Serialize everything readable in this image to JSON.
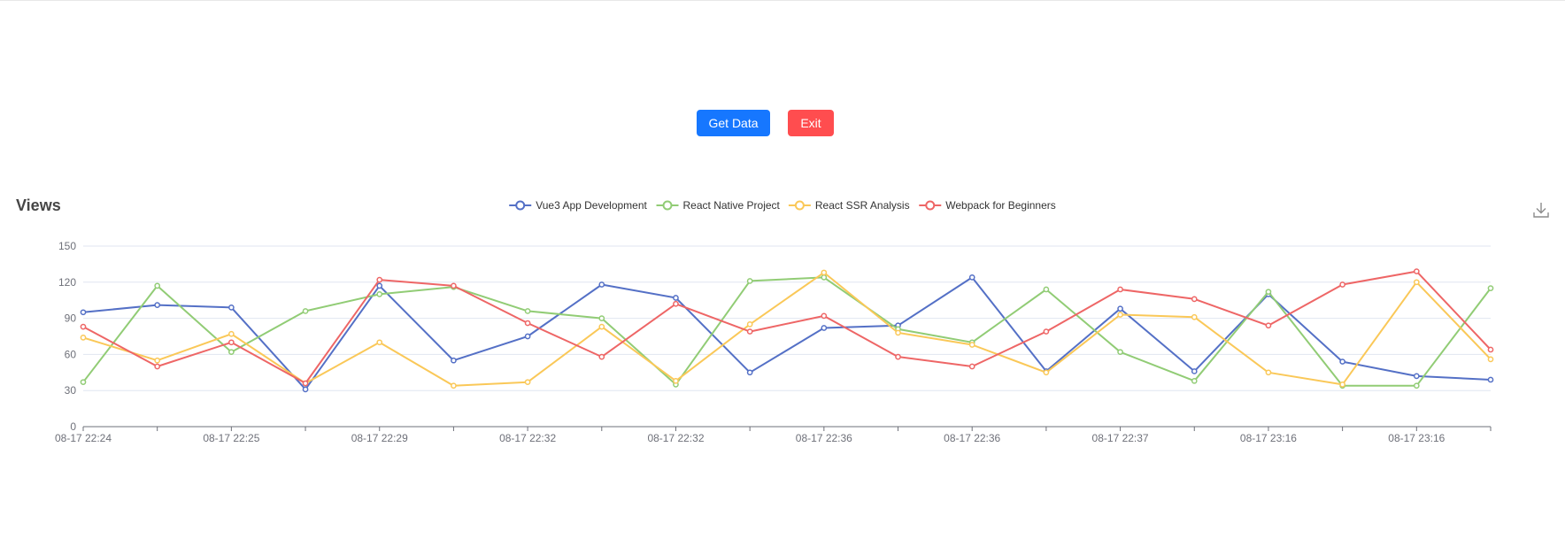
{
  "buttons": {
    "get_data": "Get Data",
    "exit": "Exit"
  },
  "colors": {
    "primary": "#1677ff",
    "danger": "#ff4d4f"
  },
  "icons": {
    "download": "download-icon"
  },
  "chart_data": {
    "type": "line",
    "title": "Views",
    "legend_position": "top-center",
    "grid": true,
    "ylim": [
      0,
      150
    ],
    "y_ticks": [
      0,
      30,
      60,
      90,
      120,
      150
    ],
    "categories": [
      "08-17 22:24",
      "",
      "08-17 22:25",
      "",
      "08-17 22:29",
      "",
      "08-17 22:32",
      "",
      "08-17 22:32",
      "",
      "08-17 22:36",
      "",
      "08-17 22:36",
      "",
      "08-17 22:37",
      "",
      "08-17 23:16",
      "",
      "08-17 23:16",
      ""
    ],
    "series": [
      {
        "name": "Vue3 App Development",
        "color": "#5470c6",
        "values": [
          95,
          101,
          99,
          31,
          117,
          55,
          75,
          118,
          107,
          45,
          82,
          84,
          124,
          46,
          98,
          46,
          110,
          54,
          42,
          39
        ]
      },
      {
        "name": "React Native Project",
        "color": "#91cc75",
        "values": [
          37,
          117,
          62,
          96,
          110,
          116,
          96,
          90,
          35,
          121,
          124,
          81,
          70,
          114,
          62,
          38,
          112,
          34,
          34,
          115
        ]
      },
      {
        "name": "React SSR Analysis",
        "color": "#fac858",
        "values": [
          74,
          55,
          77,
          36,
          70,
          34,
          37,
          83,
          38,
          85,
          128,
          78,
          68,
          45,
          93,
          91,
          45,
          35,
          120,
          56
        ]
      },
      {
        "name": "Webpack for Beginners",
        "color": "#ee6666",
        "values": [
          83,
          50,
          70,
          36,
          122,
          117,
          86,
          58,
          102,
          79,
          92,
          58,
          50,
          79,
          114,
          106,
          84,
          118,
          129,
          64
        ]
      }
    ]
  }
}
